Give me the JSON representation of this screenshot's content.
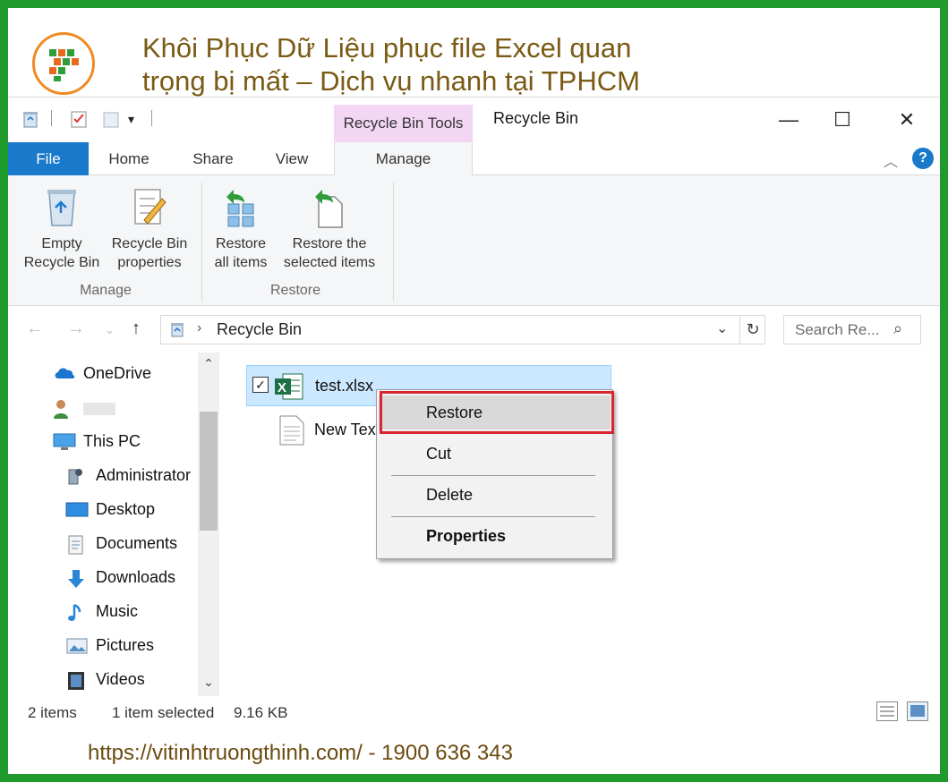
{
  "banner": {
    "title_line1": "Khôi Phục Dữ Liệu phục file Excel quan",
    "title_line2": "trọng bị mất – Dịch vụ nhanh tại TPHCM",
    "footer": "https://vitinhtruongthinh.com/ - 1900 636 343"
  },
  "window": {
    "title": "Recycle Bin",
    "context_tab_group": "Recycle Bin Tools",
    "controls": {
      "minimize": "—",
      "maximize": "☐",
      "close": "✕"
    },
    "help": "?"
  },
  "ribbon": {
    "tabs": [
      "File",
      "Home",
      "Share",
      "View",
      "Manage"
    ],
    "groups": [
      {
        "label": "Manage",
        "buttons": [
          {
            "line1": "Empty",
            "line2": "Recycle Bin",
            "icon": "recycle-bin-icon"
          },
          {
            "line1": "Recycle Bin",
            "line2": "properties",
            "icon": "properties-icon"
          }
        ]
      },
      {
        "label": "Restore",
        "buttons": [
          {
            "line1": "Restore",
            "line2": "all items",
            "icon": "restore-all-icon"
          },
          {
            "line1": "Restore the",
            "line2": "selected items",
            "icon": "restore-selected-icon"
          }
        ]
      }
    ]
  },
  "address": {
    "path": "Recycle Bin",
    "search_placeholder": "Search Re..."
  },
  "navpane": {
    "items": [
      {
        "label": "OneDrive",
        "icon": "cloud-icon"
      },
      {
        "label": "",
        "icon": "user-icon"
      },
      {
        "label": "This PC",
        "icon": "computer-icon"
      },
      {
        "label": "Administrator",
        "icon": "admin-icon"
      },
      {
        "label": "Desktop",
        "icon": "desktop-icon"
      },
      {
        "label": "Documents",
        "icon": "documents-icon"
      },
      {
        "label": "Downloads",
        "icon": "downloads-icon"
      },
      {
        "label": "Music",
        "icon": "music-icon"
      },
      {
        "label": "Pictures",
        "icon": "pictures-icon"
      },
      {
        "label": "Videos",
        "icon": "videos-icon"
      }
    ]
  },
  "files": [
    {
      "name": "test.xlsx",
      "selected": true,
      "icon": "excel-file-icon"
    },
    {
      "name": "New Tex",
      "selected": false,
      "icon": "text-file-icon"
    }
  ],
  "context_menu": {
    "items": [
      "Restore",
      "Cut",
      "Delete",
      "Properties"
    ]
  },
  "status": {
    "count": "2 items",
    "selection": "1 item selected",
    "size": "9.16 KB"
  },
  "colors": {
    "frame": "#1f9b2e",
    "file_tab": "#1979ca",
    "tools_tab": "#f3d6f4",
    "highlight": "#d9252f",
    "banner_text": "#7a5a14"
  }
}
